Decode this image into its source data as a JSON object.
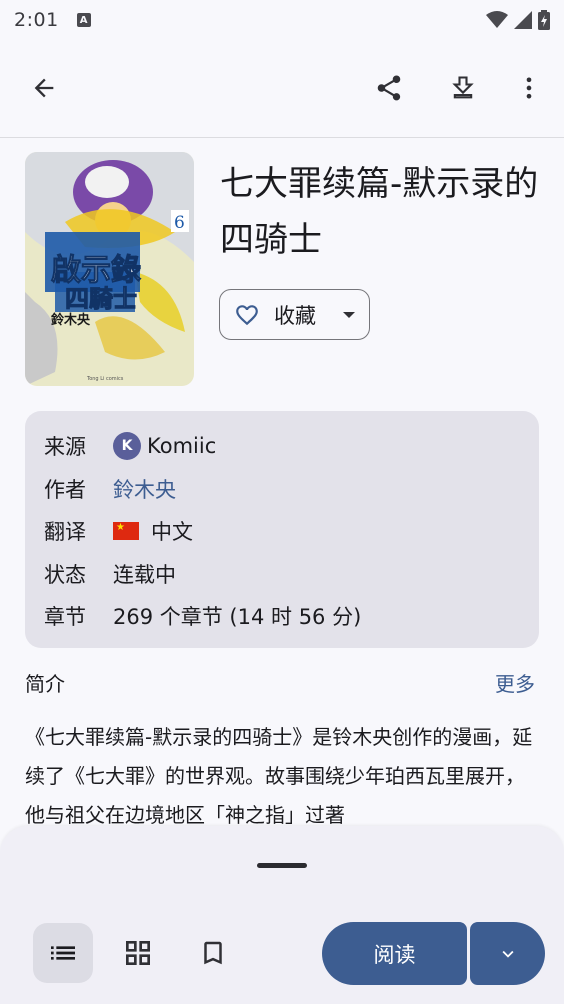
{
  "status_bar": {
    "time": "2:01"
  },
  "manga": {
    "title": "七大罪续篇-默示录的四骑士",
    "favorite_label": "收藏"
  },
  "info": {
    "rows": [
      {
        "key": "来源",
        "value": "Komiic"
      },
      {
        "key": "作者",
        "value": "鈴木央"
      },
      {
        "key": "翻译",
        "value": "中文"
      },
      {
        "key": "状态",
        "value": "连载中"
      },
      {
        "key": "章节",
        "value": "269 个章节 (14 时 56 分)"
      }
    ]
  },
  "intro": {
    "heading": "简介",
    "more_label": "更多",
    "text": "《七大罪续篇-默示录的四骑士》是铃木央创作的漫画，延续了《七大罪》的世界观。故事围绕少年珀西瓦里展开，他与祖父在边境地区「神之指」过著"
  },
  "bottom": {
    "read_label": "阅读"
  },
  "colors": {
    "accent": "#3d5d91",
    "card_bg": "#e3e2ea",
    "page_bg": "#f8f8fc"
  }
}
